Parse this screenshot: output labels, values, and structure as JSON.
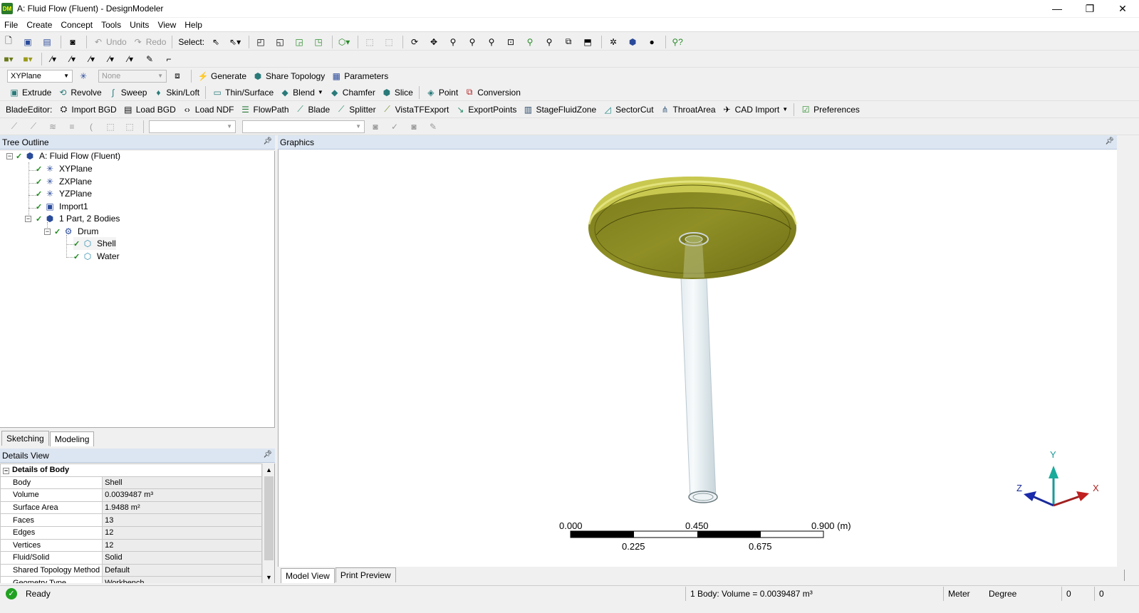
{
  "window": {
    "title": "A: Fluid Flow (Fluent) - DesignModeler",
    "logo_text": "DM",
    "minimize": "—",
    "restore": "❐",
    "close": "✕"
  },
  "menu": [
    "File",
    "Create",
    "Concept",
    "Tools",
    "Units",
    "View",
    "Help"
  ],
  "toolbar1": {
    "undo": "Undo",
    "redo": "Redo",
    "select_label": "Select:"
  },
  "toolbar3": {
    "plane": "XYPlane",
    "sketch": "None",
    "generate": "Generate",
    "share_topology": "Share Topology",
    "parameters": "Parameters"
  },
  "toolbar4": {
    "extrude": "Extrude",
    "revolve": "Revolve",
    "sweep": "Sweep",
    "skin_loft": "Skin/Loft",
    "thin_surface": "Thin/Surface",
    "blend": "Blend",
    "chamfer": "Chamfer",
    "slice": "Slice",
    "point": "Point",
    "conversion": "Conversion"
  },
  "toolbar5": {
    "blade_editor": "BladeEditor:",
    "import_bgd": "Import BGD",
    "load_bgd": "Load BGD",
    "load_ndf": "Load NDF",
    "flowpath": "FlowPath",
    "blade": "Blade",
    "splitter": "Splitter",
    "vistatfexport": "VistaTFExport",
    "exportpoints": "ExportPoints",
    "stagefluidzone": "StageFluidZone",
    "sectorcut": "SectorCut",
    "throatarea": "ThroatArea",
    "cad_import": "CAD Import",
    "preferences": "Preferences"
  },
  "tree": {
    "header": "Tree Outline",
    "root": "A: Fluid Flow (Fluent)",
    "xy": "XYPlane",
    "zx": "ZXPlane",
    "yz": "YZPlane",
    "import": "Import1",
    "parts": "1 Part, 2 Bodies",
    "drum": "Drum",
    "shell": "Shell",
    "water": "Water"
  },
  "left_tabs": {
    "sketching": "Sketching",
    "modeling": "Modeling"
  },
  "details": {
    "header": "Details View",
    "group": "Details of Body",
    "rows": [
      {
        "key": "Body",
        "value": "Shell"
      },
      {
        "key": "Volume",
        "value": "0.0039487 m³"
      },
      {
        "key": "Surface Area",
        "value": "1.9488 m²"
      },
      {
        "key": "Faces",
        "value": "13"
      },
      {
        "key": "Edges",
        "value": "12"
      },
      {
        "key": "Vertices",
        "value": "12"
      },
      {
        "key": "Fluid/Solid",
        "value": "Solid"
      },
      {
        "key": "Shared Topology Method",
        "value": "Default"
      },
      {
        "key": "Geometry Type",
        "value": "Workbench"
      }
    ]
  },
  "graphics": {
    "header": "Graphics",
    "scale": {
      "l0": "0.000",
      "l1": "0.225",
      "l2": "0.450",
      "l3": "0.675",
      "l4": "0.900 (m)"
    },
    "triad": {
      "x": "X",
      "y": "Y",
      "z": "Z"
    }
  },
  "right_tabs": {
    "model_view": "Model View",
    "print_preview": "Print Preview"
  },
  "status": {
    "state": "Ready",
    "selection": "1 Body: Volume = 0.0039487 m³",
    "length_unit": "Meter",
    "angle_unit": "Degree",
    "v1": "0",
    "v2": "0"
  },
  "colors": {
    "panel_header": "#dce6f2",
    "body_fill": "#8a8a1e",
    "body_rim": "#c8c84a"
  }
}
